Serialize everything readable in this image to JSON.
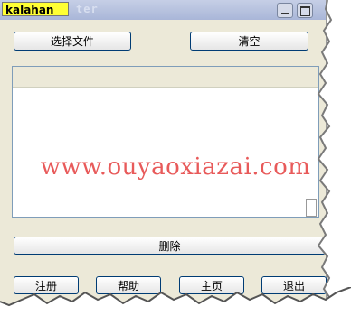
{
  "window": {
    "title_label": "kalahan",
    "title_suffix": "ter"
  },
  "toolbar": {
    "select_file_label": "选择文件",
    "clear_label": "清空"
  },
  "actions": {
    "delete_label": "删除"
  },
  "footer": {
    "register_label": "注册",
    "help_label": "帮助",
    "home_label": "主页",
    "exit_label": "退出"
  },
  "watermark": "www.ouyaoxiazai.com",
  "colors": {
    "highlight": "#ffff33",
    "window_bg": "#ece9d8",
    "button_border": "#003c74",
    "watermark": "#e85a5a"
  }
}
